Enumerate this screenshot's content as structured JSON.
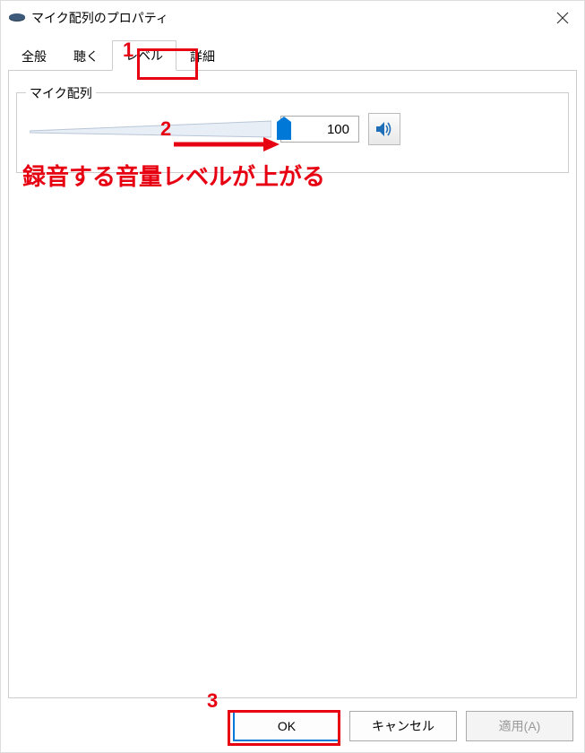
{
  "window": {
    "title": "マイク配列のプロパティ"
  },
  "tabs": {
    "general": "全般",
    "listen": "聴く",
    "level": "レベル",
    "advanced": "詳細"
  },
  "group": {
    "label": "マイク配列",
    "value": "100"
  },
  "buttons": {
    "ok": "OK",
    "cancel": "キャンセル",
    "apply": "適用(A)"
  },
  "annotations": {
    "num1": "1",
    "num2": "2",
    "num3": "3",
    "text": "録音する音量レベルが上がる"
  },
  "colors": {
    "accent": "#0078d7",
    "annotation": "#e60012"
  }
}
